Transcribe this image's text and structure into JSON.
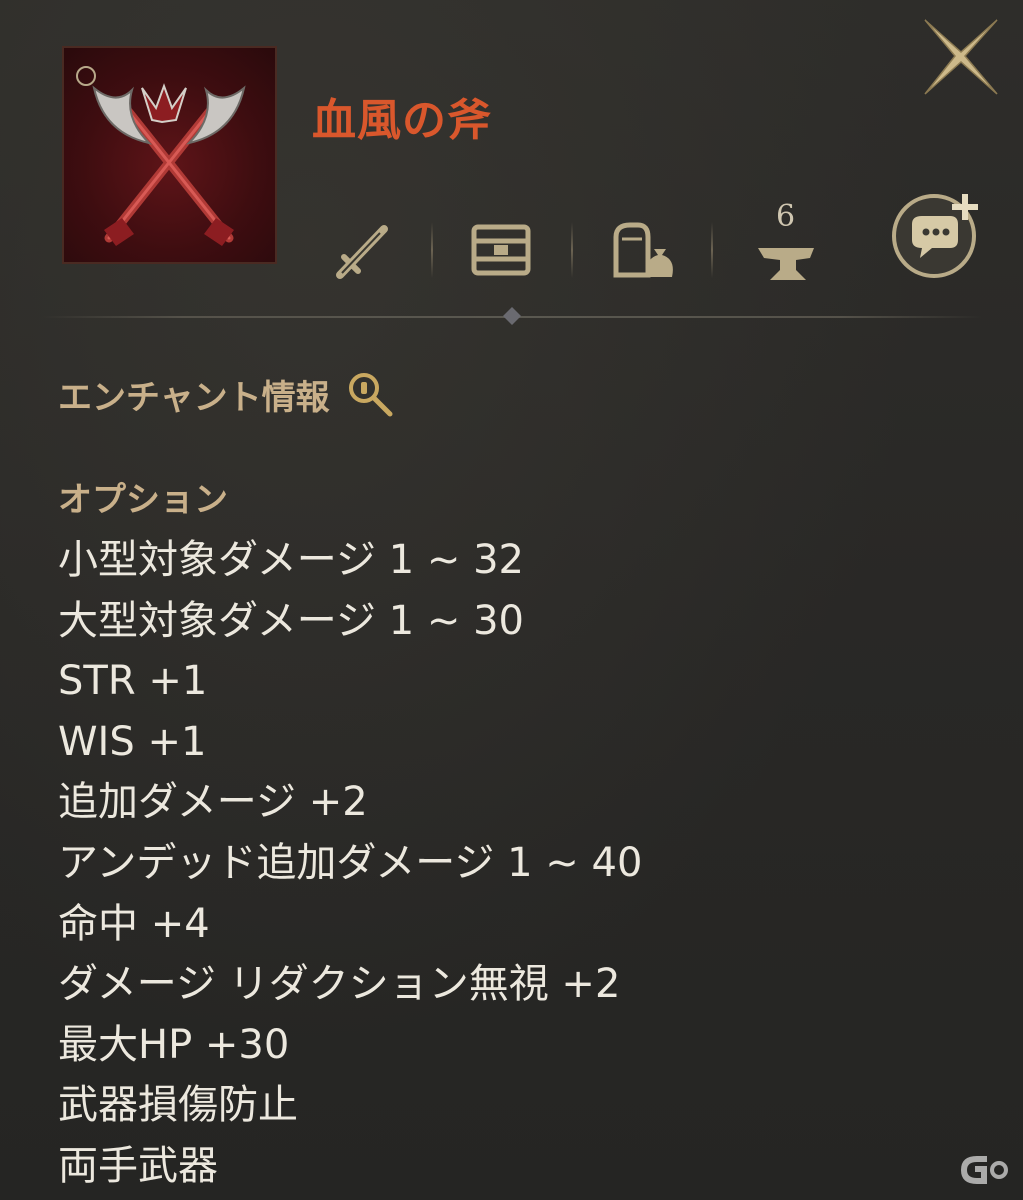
{
  "item": {
    "name": "血風の斧",
    "name_color": "#d9572c",
    "icon": "crossed-blood-axes-icon"
  },
  "toolbar": {
    "buttons": [
      {
        "icon": "sword-icon"
      },
      {
        "icon": "treasure-chest-icon"
      },
      {
        "icon": "shop-bag-icon"
      },
      {
        "icon": "anvil-icon"
      }
    ],
    "enhance_level": "6",
    "chat_add_icon": "chat-add-icon",
    "close_icon": "close-icon"
  },
  "enchant": {
    "label": "エンチャント情報",
    "icon": "magnifier-icon"
  },
  "options": {
    "header": "オプション",
    "items": [
      "小型対象ダメージ 1 ~ 32",
      "大型対象ダメージ 1 ~ 30",
      "STR +1",
      "WIS +1",
      "追加ダメージ +2",
      "アンデッド追加ダメージ 1 ~ 40",
      "命中 +4",
      "ダメージ リダクション無視 +2",
      "最大HP +30",
      "武器損傷防止",
      "両手武器"
    ]
  },
  "colors": {
    "background": "#2a2a28",
    "label": "#c9b08a",
    "text": "#ece8de",
    "icon_gold": "#b9ab88"
  }
}
